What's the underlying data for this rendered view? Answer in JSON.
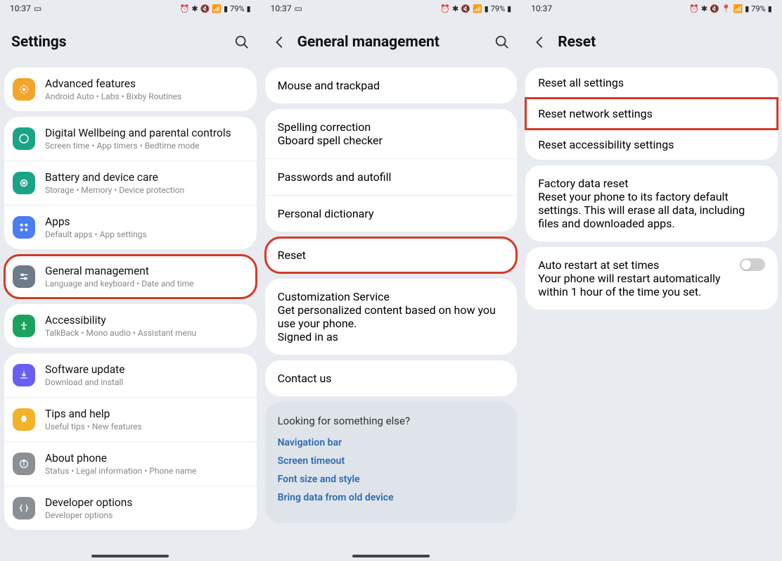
{
  "status": {
    "time": "10:37",
    "battery": "79%"
  },
  "screen1": {
    "title": "Settings",
    "items": [
      {
        "icon": "advanced",
        "color": "#f2a52a",
        "title": "Advanced features",
        "sub": "Android Auto  •  Labs  •  Bixby Routines"
      },
      {
        "icon": "wellbeing",
        "color": "#1aa387",
        "title": "Digital Wellbeing and parental controls",
        "sub": "Screen time  •  App timers  •  Bedtime mode"
      },
      {
        "icon": "battery",
        "color": "#1aa387",
        "title": "Battery and device care",
        "sub": "Storage  •  Memory  •  Device protection"
      },
      {
        "icon": "apps",
        "color": "#4a7ef0",
        "title": "Apps",
        "sub": "Default apps  •  App settings"
      },
      {
        "icon": "general",
        "color": "#6d7b8a",
        "title": "General management",
        "sub": "Language and keyboard  •  Date and time"
      },
      {
        "icon": "accessibility",
        "color": "#1ba35c",
        "title": "Accessibility",
        "sub": "TalkBack  •  Mono audio  •  Assistant menu"
      },
      {
        "icon": "software",
        "color": "#6a5ef0",
        "title": "Software update",
        "sub": "Download and install"
      },
      {
        "icon": "tips",
        "color": "#f2b22a",
        "title": "Tips and help",
        "sub": "Useful tips  •  New features"
      },
      {
        "icon": "about",
        "color": "#8a8f94",
        "title": "About phone",
        "sub": "Status  •  Legal information  •  Phone name"
      },
      {
        "icon": "dev",
        "color": "#8a8f94",
        "title": "Developer options",
        "sub": "Developer options"
      }
    ]
  },
  "screen2": {
    "title": "General management",
    "group1": [
      {
        "title": "Mouse and trackpad"
      }
    ],
    "group2": [
      {
        "title": "Spelling correction",
        "sub": "Gboard spell checker"
      },
      {
        "title": "Passwords and autofill"
      },
      {
        "title": "Personal dictionary"
      }
    ],
    "reset": {
      "title": "Reset"
    },
    "group3": [
      {
        "title": "Customization Service",
        "sub": "Get personalized content based on how you use your phone.",
        "link": "Signed in as"
      }
    ],
    "group4": [
      {
        "title": "Contact us"
      }
    ],
    "footer": {
      "heading": "Looking for something else?",
      "links": [
        "Navigation bar",
        "Screen timeout",
        "Font size and style",
        "Bring data from old device"
      ]
    }
  },
  "screen3": {
    "title": "Reset",
    "group1": [
      {
        "title": "Reset all settings"
      },
      {
        "title": "Reset network settings"
      },
      {
        "title": "Reset accessibility settings"
      }
    ],
    "group2": [
      {
        "title": "Factory data reset",
        "sub": "Reset your phone to its factory default settings. This will erase all data, including files and downloaded apps."
      }
    ],
    "group3": [
      {
        "title": "Auto restart at set times",
        "sub": "Your phone will restart automatically within 1 hour of the time you set."
      }
    ]
  }
}
